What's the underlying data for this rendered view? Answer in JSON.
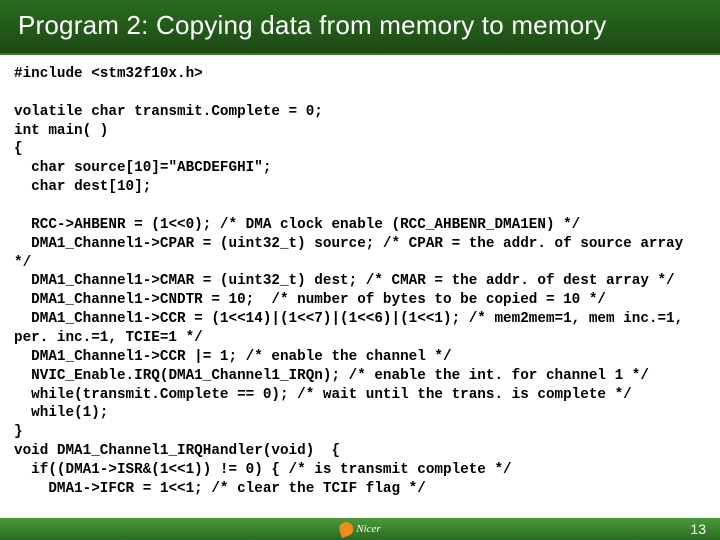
{
  "title": "Program 2: Copying data from memory to memory",
  "code_lines": [
    "#include <stm32f10x.h>",
    "",
    "volatile char transmit.Complete = 0;",
    "int main( )",
    "{",
    "  char source[10]=\"ABCDEFGHI\";",
    "  char dest[10];",
    "",
    "  RCC->AHBENR = (1<<0); /* DMA clock enable (RCC_AHBENR_DMA1EN) */",
    "  DMA1_Channel1->CPAR = (uint32_t) source; /* CPAR = the addr. of source array */",
    "  DMA1_Channel1->CMAR = (uint32_t) dest; /* CMAR = the addr. of dest array */",
    "  DMA1_Channel1->CNDTR = 10;  /* number of bytes to be copied = 10 */",
    "  DMA1_Channel1->CCR = (1<<14)|(1<<7)|(1<<6)|(1<<1); /* mem2mem=1, mem inc.=1, per. inc.=1, TCIE=1 */",
    "  DMA1_Channel1->CCR |= 1; /* enable the channel */",
    "  NVIC_Enable.IRQ(DMA1_Channel1_IRQn); /* enable the int. for channel 1 */",
    "  while(transmit.Complete == 0); /* wait until the trans. is complete */",
    "  while(1);",
    "}",
    "void DMA1_Channel1_IRQHandler(void)  {",
    "  if((DMA1->ISR&(1<<1)) != 0) { /* is transmit complete */",
    "    DMA1->IFCR = 1<<1; /* clear the TCIF flag */"
  ],
  "footer": {
    "logo_text": "Nicer",
    "page_number": "13"
  }
}
